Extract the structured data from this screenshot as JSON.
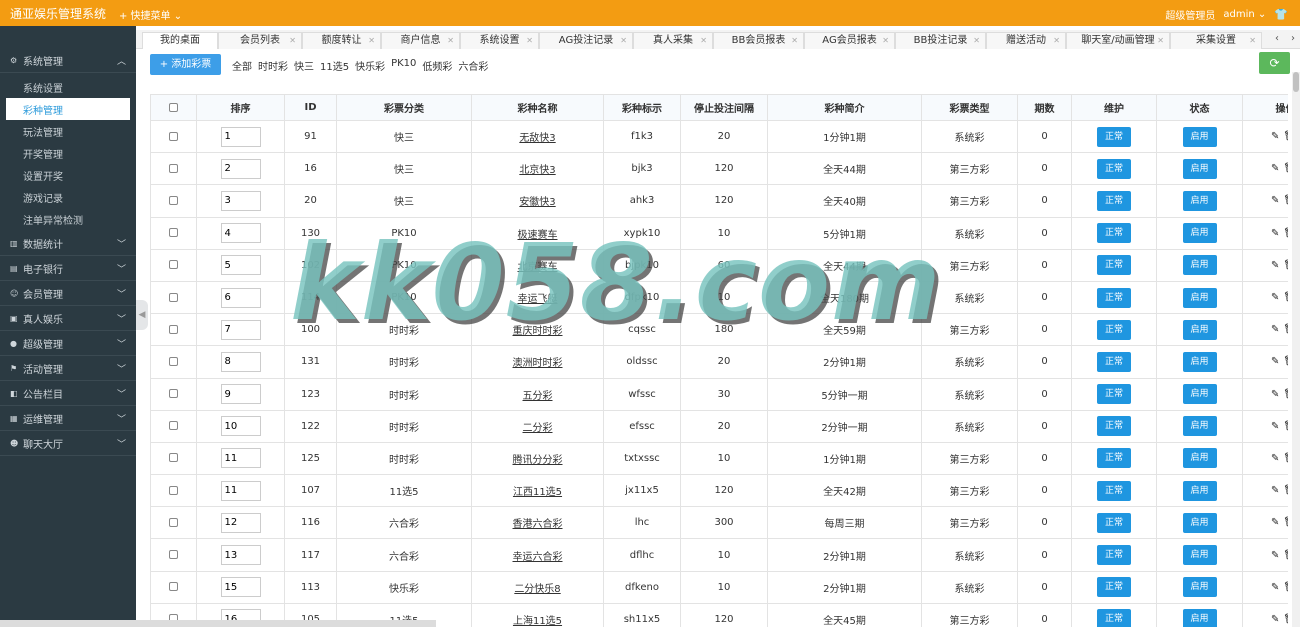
{
  "header": {
    "brand": "通亚娱乐管理系统",
    "quick_menu": "+ 快捷菜单 ⌄",
    "role": "超级管理员",
    "user": "admin ⌄"
  },
  "sidebar": {
    "groups": [
      {
        "label": "系统管理",
        "icon": "gear-icon"
      },
      {
        "label": "数据统计",
        "icon": "bar-chart-icon"
      },
      {
        "label": "电子银行",
        "icon": "bank-icon"
      },
      {
        "label": "会员管理",
        "icon": "user-icon"
      },
      {
        "label": "真人娱乐",
        "icon": "video-icon"
      },
      {
        "label": "超级管理",
        "icon": "user-icon"
      },
      {
        "label": "活动管理",
        "icon": "flag-icon"
      },
      {
        "label": "公告栏目",
        "icon": "bullhorn-icon"
      },
      {
        "label": "运维管理",
        "icon": "wrench-icon"
      },
      {
        "label": "聊天大厅",
        "icon": "chat-icon"
      }
    ],
    "items": [
      "系统设置",
      "彩种管理",
      "玩法管理",
      "开奖管理",
      "设置开奖",
      "游戏记录",
      "注单异常检测"
    ]
  },
  "tabs": [
    "我的桌面",
    "会员列表",
    "额度转让",
    "商户信息",
    "系统设置",
    "AG投注记录",
    "真人采集",
    "BB会员报表",
    "AG会员报表",
    "BB投注记录",
    "赠送活动",
    "聊天室/动画管理",
    "采集设置"
  ],
  "toolbar": {
    "add_label": "+ 添加彩票",
    "filters": [
      "全部",
      "时时彩",
      "快三",
      "11选5",
      "快乐彩",
      "PK10",
      "低频彩",
      "六合彩"
    ]
  },
  "table": {
    "headers": [
      "排序",
      "ID",
      "彩票分类",
      "彩种名称",
      "彩种标示",
      "停止投注间隔",
      "彩种简介",
      "彩票类型",
      "期数",
      "维护",
      "状态",
      "操作"
    ],
    "status_label": "正常",
    "enable_label": "启用",
    "rows": [
      {
        "order": "1",
        "id": "91",
        "category": "快三",
        "name": "无敌快3",
        "code": "f1k3",
        "interval": "20",
        "intro": "1分钟1期",
        "type": "系统彩",
        "periods": "0"
      },
      {
        "order": "2",
        "id": "16",
        "category": "快三",
        "name": "北京快3",
        "code": "bjk3",
        "interval": "120",
        "intro": "全天44期",
        "type": "第三方彩",
        "periods": "0"
      },
      {
        "order": "3",
        "id": "20",
        "category": "快三",
        "name": "安徽快3",
        "code": "ahk3",
        "interval": "120",
        "intro": "全天40期",
        "type": "第三方彩",
        "periods": "0"
      },
      {
        "order": "4",
        "id": "130",
        "category": "PK10",
        "name": "极速赛车",
        "code": "xypk10",
        "interval": "10",
        "intro": "5分钟1期",
        "type": "系统彩",
        "periods": "0"
      },
      {
        "order": "5",
        "id": "102",
        "category": "PK10",
        "name": "北京赛车",
        "code": "bjpk10",
        "interval": "60",
        "intro": "全天44期",
        "type": "第三方彩",
        "periods": "0"
      },
      {
        "order": "6",
        "id": "114",
        "category": "PK10",
        "name": "幸运飞艇",
        "code": "dfpk10",
        "interval": "10",
        "intro": "全天180期",
        "type": "系统彩",
        "periods": "0"
      },
      {
        "order": "7",
        "id": "100",
        "category": "时时彩",
        "name": "重庆时时彩",
        "code": "cqssc",
        "interval": "180",
        "intro": "全天59期",
        "type": "第三方彩",
        "periods": "0"
      },
      {
        "order": "8",
        "id": "131",
        "category": "时时彩",
        "name": "澳洲时时彩",
        "code": "oldssc",
        "interval": "20",
        "intro": "2分钟1期",
        "type": "系统彩",
        "periods": "0"
      },
      {
        "order": "9",
        "id": "123",
        "category": "时时彩",
        "name": "五分彩",
        "code": "wfssc",
        "interval": "30",
        "intro": "5分钟一期",
        "type": "系统彩",
        "periods": "0"
      },
      {
        "order": "10",
        "id": "122",
        "category": "时时彩",
        "name": "二分彩",
        "code": "efssc",
        "interval": "20",
        "intro": "2分钟一期",
        "type": "系统彩",
        "periods": "0"
      },
      {
        "order": "11",
        "id": "125",
        "category": "时时彩",
        "name": "腾讯分分彩",
        "code": "txtxssc",
        "interval": "10",
        "intro": "1分钟1期",
        "type": "第三方彩",
        "periods": "0"
      },
      {
        "order": "11",
        "id": "107",
        "category": "11选5",
        "name": "江西11选5",
        "code": "jx11x5",
        "interval": "120",
        "intro": "全天42期",
        "type": "第三方彩",
        "periods": "0"
      },
      {
        "order": "12",
        "id": "116",
        "category": "六合彩",
        "name": "香港六合彩",
        "code": "lhc",
        "interval": "300",
        "intro": "每周三期",
        "type": "第三方彩",
        "periods": "0"
      },
      {
        "order": "13",
        "id": "117",
        "category": "六合彩",
        "name": "幸运六合彩",
        "code": "dflhc",
        "interval": "10",
        "intro": "2分钟1期",
        "type": "系统彩",
        "periods": "0"
      },
      {
        "order": "15",
        "id": "113",
        "category": "快乐彩",
        "name": "二分快乐8",
        "code": "dfkeno",
        "interval": "10",
        "intro": "2分钟1期",
        "type": "系统彩",
        "periods": "0"
      },
      {
        "order": "16",
        "id": "105",
        "category": "11选5",
        "name": "上海11选5",
        "code": "sh11x5",
        "interval": "120",
        "intro": "全天45期",
        "type": "第三方彩",
        "periods": "0"
      }
    ]
  },
  "watermark": "kk058.com"
}
